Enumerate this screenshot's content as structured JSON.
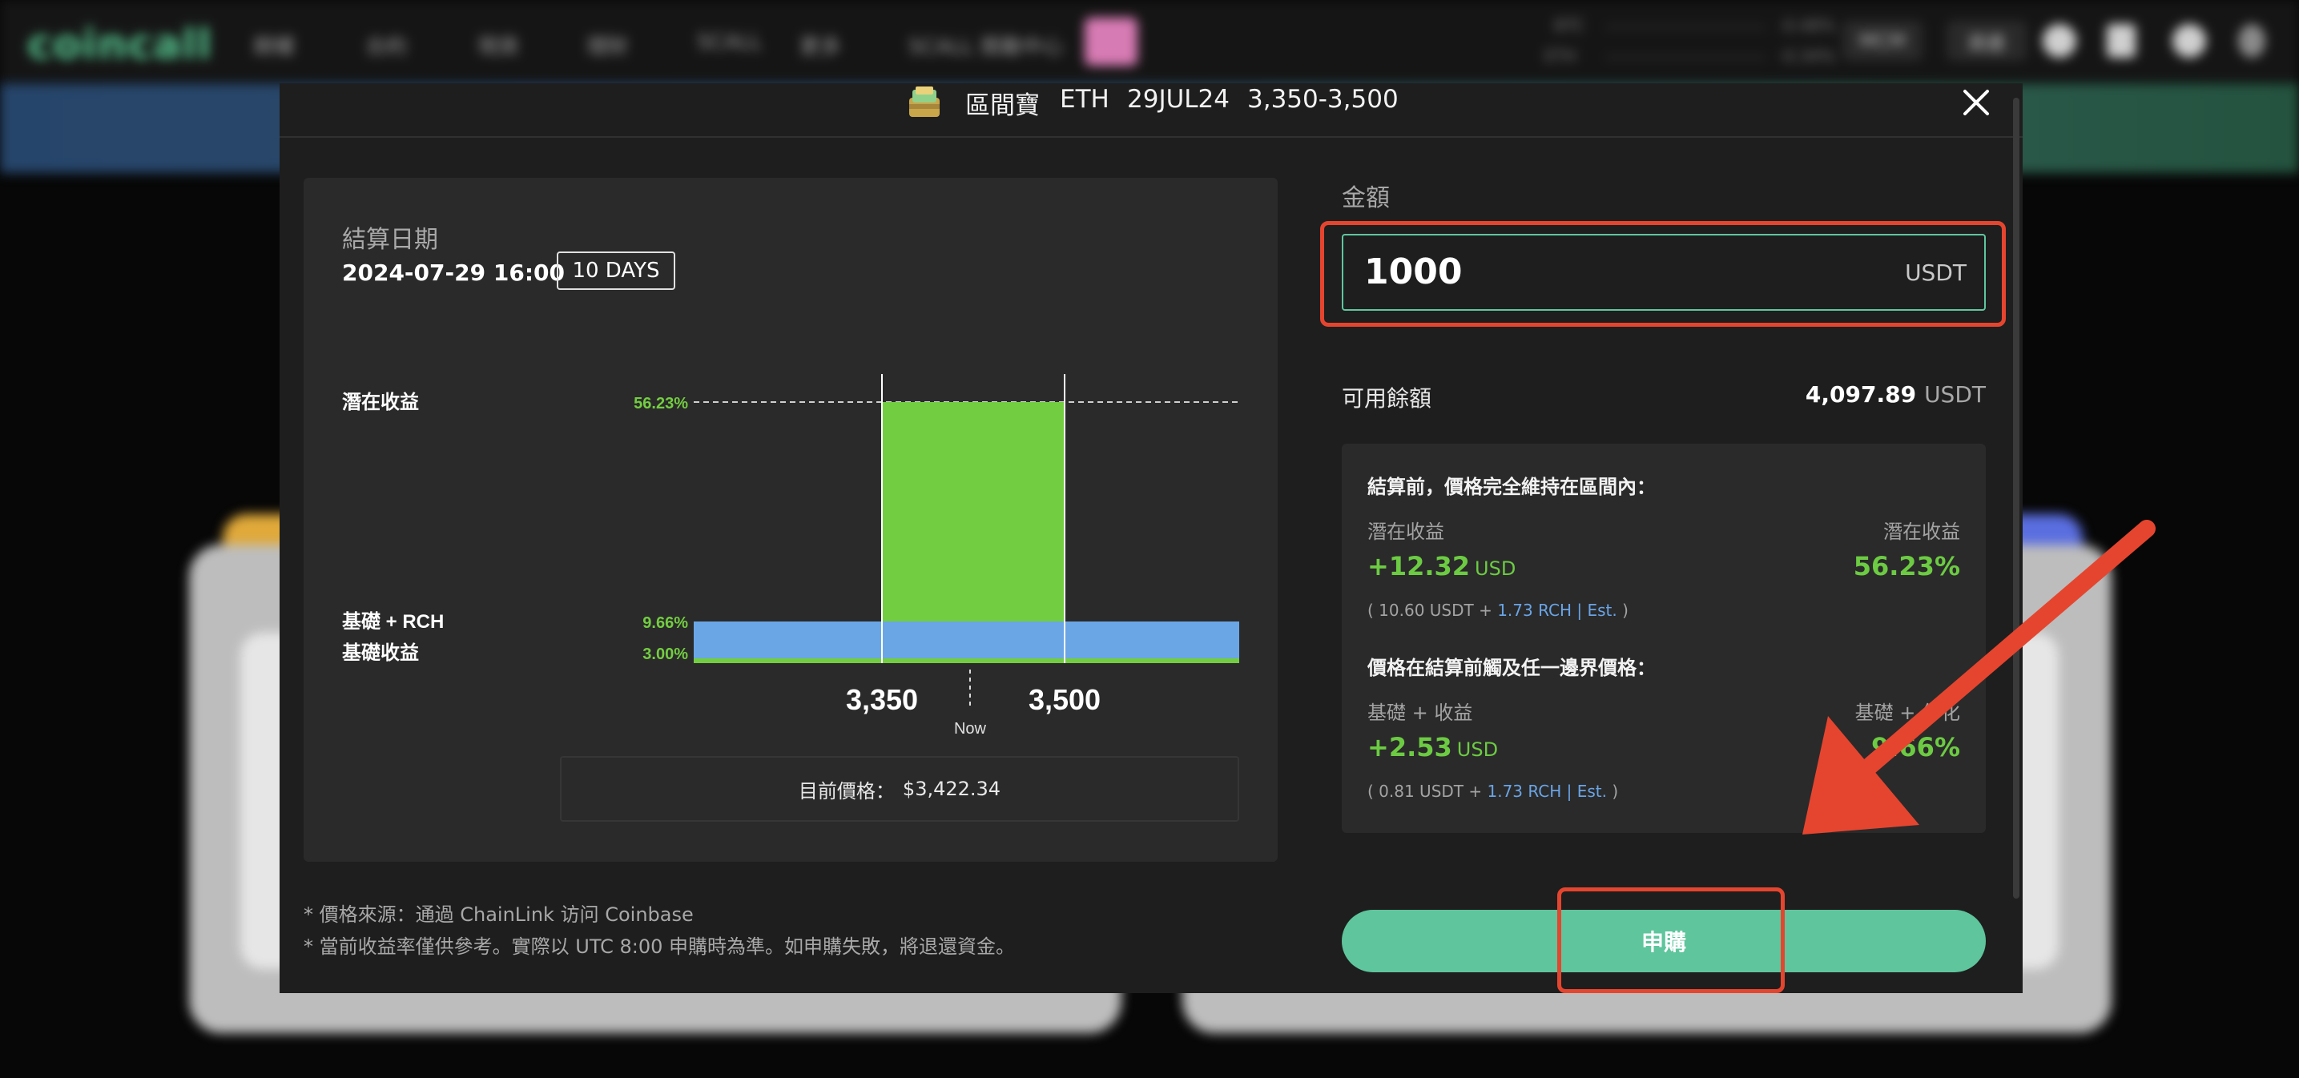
{
  "site": {
    "logo": "coincall",
    "nav_items": [
      "期權",
      "合約",
      "現貨",
      "理財",
      "SCALL",
      "更多",
      "SCALL 獎勵中心"
    ],
    "tickers": [
      {
        "symbol": "BTC",
        "change": "-0.48%"
      },
      {
        "symbol": "ETH",
        "change": "-0.34%"
      }
    ],
    "mcm_label": "MCM",
    "account_label": "資產"
  },
  "modal": {
    "title": {
      "product": "區間寶",
      "asset": "ETH",
      "expiry": "29JUL24",
      "range": "3,350-3,500"
    },
    "settlement": {
      "label": "結算日期",
      "datetime": "2024-07-29 16:00",
      "days_badge": "10 DAYS"
    },
    "chart_labels": {
      "potential": "潛在收益",
      "base_rch": "基礎 + RCH",
      "base": "基礎收益",
      "now": "Now"
    },
    "current_price": {
      "label": "目前價格：",
      "value": "$3,422.34"
    },
    "footnotes": [
      "* 價格來源：通過 ChainLink 访问 Coinbase",
      "* 當前收益率僅供參考。實際以 UTC 8:00 申購時為準。如申購失敗，將退還資金。"
    ],
    "amount": {
      "label": "金額",
      "value": "1000",
      "unit": "USDT"
    },
    "balance": {
      "label": "可用餘額",
      "value": "4,097.89",
      "unit": "USDT"
    },
    "scenario_in_range": {
      "heading": "結算前，價格完全維持在區間內：",
      "left_label": "潛在收益",
      "left_value": "+12.32",
      "left_unit": "USD",
      "right_label": "潛在收益",
      "right_value": "56.23%",
      "note_prefix": "( 10.60 USDT + ",
      "note_link": "1.73 RCH | Est.",
      "note_suffix": " )"
    },
    "scenario_touch": {
      "heading": "價格在結算前觸及任一邊界價格：",
      "left_label": "基礎 + 收益",
      "left_value": "+2.53",
      "left_unit": "USD",
      "right_label": "基礎 + 年化",
      "right_value": "9.66%",
      "note_prefix": "( 0.81 USDT + ",
      "note_link": "1.73 RCH | Est.",
      "note_suffix": " )"
    },
    "subscribe_label": "申購"
  },
  "chart_data": {
    "type": "area",
    "x_ticks": [
      "3,350",
      "3,500"
    ],
    "levels": [
      {
        "label": "潛在收益",
        "value": 56.23,
        "text": "56.23%",
        "color": "#73cd41",
        "range": [
          "3,350",
          "3,500"
        ]
      },
      {
        "label": "基礎 + RCH",
        "value": 9.66,
        "text": "9.66%",
        "color": "#6aa6e6"
      },
      {
        "label": "基礎收益",
        "value": 3.0,
        "text": "3.00%",
        "color": "#73cd41"
      }
    ],
    "current_price": 3422.34
  },
  "colors": {
    "accent_green": "#5ec59c",
    "yield_green": "#6ccb43",
    "rch_blue": "#6aa4e6",
    "annotation_red": "#e5452f"
  }
}
